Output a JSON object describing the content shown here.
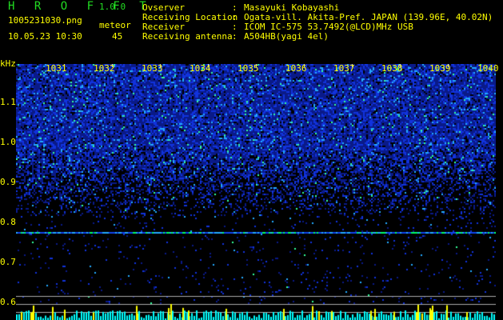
{
  "app": {
    "title": "H R O F F T",
    "version": "1.0.0"
  },
  "capture": {
    "filename": "1005231030.png",
    "datetime": "10.05.23 10:30",
    "meteor_label": "meteor",
    "meteor_count": "45"
  },
  "info": [
    {
      "key": "Ovserver",
      "value": "Masayuki Kobayashi"
    },
    {
      "key": "Receiving Location",
      "value": "Ogata-vill. Akita-Pref. JAPAN (139.96E, 40.02N)"
    },
    {
      "key": "Receiver",
      "value": "ICOM IC-575 53.7492(@LCD)MHz USB"
    },
    {
      "key": "Receiving antenna",
      "value": "A504HB(yagi 4el)"
    }
  ],
  "separator": ":",
  "spectrogram": {
    "y_unit": "kHz",
    "y_ticks": [
      "1.1",
      "1.0",
      "0.9",
      "0.8",
      "0.7",
      "0.6"
    ],
    "x_ticks": [
      "1031",
      "1032",
      "1033",
      "1034",
      "1035",
      "1036",
      "1037",
      "1038",
      "1039",
      "1040"
    ],
    "carrier_khz": 0.78,
    "colors": {
      "text": "#ffff00",
      "title": "#22dd22",
      "histogram": "#00ffff",
      "histogram_peak": "#ffff00",
      "carrier": "#00ff66",
      "grid": "#aaaaaa"
    }
  }
}
